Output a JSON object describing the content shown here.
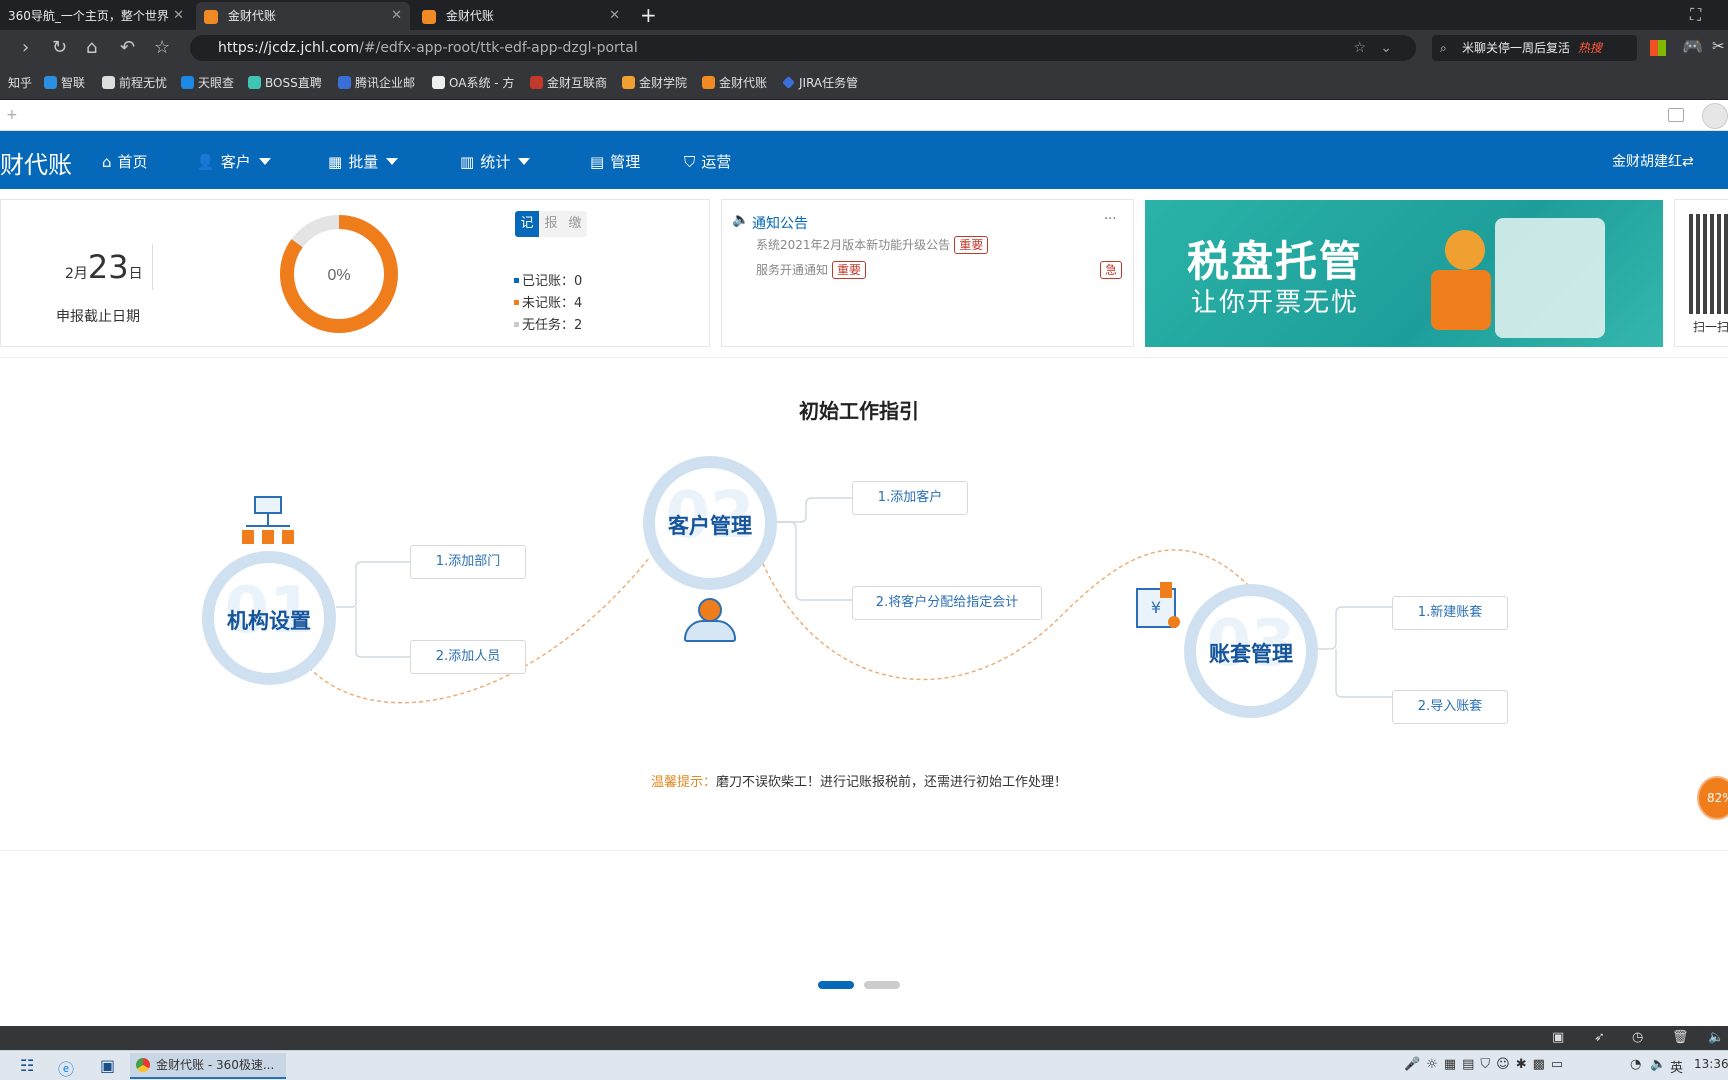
{
  "browser": {
    "tabs": [
      {
        "label": "360导航_一个主页，整个世界"
      },
      {
        "label": "金财代账"
      },
      {
        "label": "金财代账"
      }
    ],
    "new_tab": "+",
    "url_host": "https://jcdz.jchl.com",
    "url_path": "/#/edfx-app-root/ttk-edf-app-dzgl-portal",
    "search_text": "米聊关停一周后复活",
    "search_badge": "热搜",
    "bookmarks": [
      "知乎",
      "智联",
      "前程无忧",
      "天眼查",
      "BOSS直聘",
      "腾讯企业邮",
      "OA系统 - 方",
      "金财互联商",
      "金财学院",
      "金财代账",
      "JIRA任务管"
    ]
  },
  "app": {
    "logo": "财代账",
    "menu": [
      {
        "label": "首页",
        "icon": "home-icon",
        "glyph": "⌂",
        "caret": false
      },
      {
        "label": "客户",
        "icon": "user-icon",
        "glyph": "👤",
        "caret": true
      },
      {
        "label": "批量",
        "icon": "batch-icon",
        "glyph": "▦",
        "caret": true
      },
      {
        "label": "统计",
        "icon": "chart-icon",
        "glyph": "▥",
        "caret": true
      },
      {
        "label": "管理",
        "icon": "manage-icon",
        "glyph": "▤",
        "caret": false
      },
      {
        "label": "运营",
        "icon": "shield-icon",
        "glyph": "⛉",
        "caret": false
      }
    ],
    "user": "金财胡建红⇄"
  },
  "summary": {
    "date_month": "2月",
    "date_day": "23",
    "date_suffix": "日",
    "deadline_label": "申报截止日期",
    "progress_text": "0%",
    "progress_fraction": 0.85,
    "segments": [
      "记",
      "报",
      "缴"
    ],
    "legend": [
      {
        "label": "已记账：",
        "value": "0",
        "color": "#0668b8"
      },
      {
        "label": "未记账：",
        "value": "4",
        "color": "#f07d1c"
      },
      {
        "label": "无任务：",
        "value": "2",
        "color": "#cccccc"
      }
    ]
  },
  "notice": {
    "title": "通知公告",
    "more": "···",
    "items": [
      {
        "text": "系统2021年2月版本新功能升级公告",
        "tag": "重要"
      },
      {
        "text": "服务开通通知",
        "tag": "重要",
        "flag": "急"
      }
    ]
  },
  "banner": {
    "line1": "税盘托管",
    "line2": "让你开票无忧"
  },
  "qr": {
    "caption": "扫一扫"
  },
  "guide": {
    "title": "初始工作指引",
    "steps": [
      {
        "num": "01",
        "title": "机构设置",
        "items": [
          "1.添加部门",
          "2.添加人员"
        ]
      },
      {
        "num": "02",
        "title": "客户管理",
        "items": [
          "1.添加客户",
          "2.将客户分配给指定会计"
        ]
      },
      {
        "num": "03",
        "title": "账套管理",
        "items": [
          "1.新建账套",
          "2.导入账套"
        ]
      }
    ],
    "tip_label": "温馨提示：",
    "tip_text": "磨刀不误砍柴工！进行记账报税前，还需进行初始工作处理！"
  },
  "float_badge": "82%",
  "taskbar": {
    "app_label": "金财代账 - 360极速...",
    "lang": "英",
    "time": "13:36"
  }
}
